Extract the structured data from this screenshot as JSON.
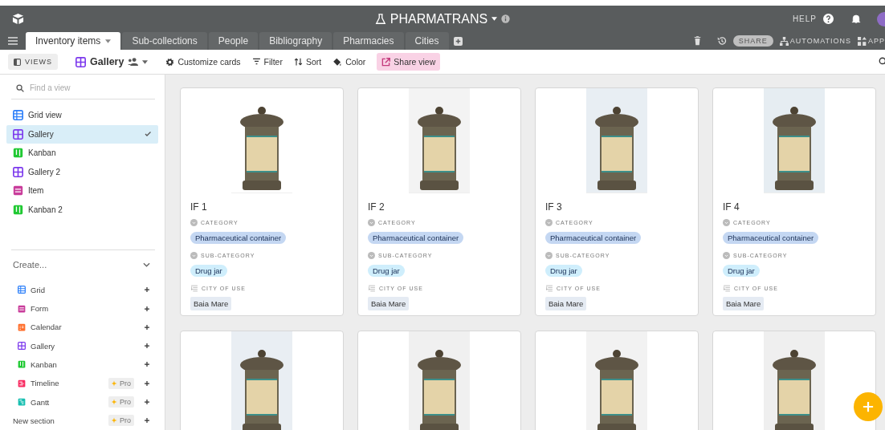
{
  "header": {
    "base_name": "PHARMATRANS",
    "help": "HELP"
  },
  "tabs": [
    {
      "label": "Inventory items",
      "selected": true
    },
    {
      "label": "Sub-collections",
      "selected": false
    },
    {
      "label": "People",
      "selected": false
    },
    {
      "label": "Bibliography",
      "selected": false
    },
    {
      "label": "Pharmacies",
      "selected": false
    },
    {
      "label": "Cities",
      "selected": false
    }
  ],
  "tab_actions": {
    "share": "SHARE",
    "automations": "AUTOMATIONS",
    "apps": "APP"
  },
  "toolbar": {
    "views": "VIEWS",
    "view_name": "Gallery",
    "customize": "Customize cards",
    "filter": "Filter",
    "sort": "Sort",
    "color_label": "Color",
    "share_view": "Share view"
  },
  "sidebar": {
    "search_placeholder": "Find a view",
    "views": [
      {
        "label": "Grid view",
        "kind": "grid",
        "color": "#2d7ff9",
        "selected": false
      },
      {
        "label": "Gallery",
        "kind": "gallery",
        "color": "#7c39ed",
        "selected": true
      },
      {
        "label": "Kanban",
        "kind": "kanban",
        "color": "#20c933",
        "selected": false
      },
      {
        "label": "Gallery 2",
        "kind": "gallery",
        "color": "#7c39ed",
        "selected": false
      },
      {
        "label": "Item",
        "kind": "form",
        "color": "#c93d9b",
        "selected": false
      },
      {
        "label": "Kanban 2",
        "kind": "kanban",
        "color": "#20c933",
        "selected": false
      }
    ],
    "create_label": "Create...",
    "create_items": [
      {
        "label": "Grid",
        "kind": "grid",
        "color": "#2d7ff9"
      },
      {
        "label": "Form",
        "kind": "form",
        "color": "#c93d9b"
      },
      {
        "label": "Calendar",
        "kind": "calendar",
        "color": "#ff6f2c"
      },
      {
        "label": "Gallery",
        "kind": "gallery",
        "color": "#7c39ed"
      },
      {
        "label": "Kanban",
        "kind": "kanban",
        "color": "#20c933"
      },
      {
        "label": "Timeline",
        "kind": "timeline",
        "color": "#f82b60",
        "badge": "Pro"
      },
      {
        "label": "Gantt",
        "kind": "gantt",
        "color": "#18bfb1",
        "badge": "Pro"
      },
      {
        "label": "New section",
        "kind": "section",
        "badge": "Pro"
      }
    ]
  },
  "cards": [
    {
      "title": "IF 1",
      "fields": [
        {
          "label": "CATEGORY",
          "kind": "select",
          "value": "Pharmaceutical container",
          "color": "#c4d7f2"
        },
        {
          "label": "SUB-CATEGORY",
          "kind": "select",
          "value": "Drug jar",
          "color": "#cfeefc"
        },
        {
          "label": "CITY OF USE",
          "kind": "link",
          "value": "Baia Mare"
        }
      ]
    },
    {
      "title": "IF 2",
      "fields": [
        {
          "label": "CATEGORY",
          "kind": "select",
          "value": "Pharmaceutical container",
          "color": "#c4d7f2"
        },
        {
          "label": "SUB-CATEGORY",
          "kind": "select",
          "value": "Drug jar",
          "color": "#cfeefc"
        },
        {
          "label": "CITY OF USE",
          "kind": "link",
          "value": "Baia Mare"
        }
      ]
    },
    {
      "title": "IF 3",
      "fields": [
        {
          "label": "CATEGORY",
          "kind": "select",
          "value": "Pharmaceutical container",
          "color": "#c4d7f2"
        },
        {
          "label": "SUB-CATEGORY",
          "kind": "select",
          "value": "Drug jar",
          "color": "#cfeefc"
        },
        {
          "label": "CITY OF USE",
          "kind": "link",
          "value": "Baia Mare"
        }
      ]
    },
    {
      "title": "IF 4",
      "fields": [
        {
          "label": "CATEGORY",
          "kind": "select",
          "value": "Pharmaceutical container",
          "color": "#c4d7f2"
        },
        {
          "label": "SUB-CATEGORY",
          "kind": "select",
          "value": "Drug jar",
          "color": "#cfeefc"
        },
        {
          "label": "CITY OF USE",
          "kind": "link",
          "value": "Baia Mare"
        }
      ]
    },
    {
      "kind": "photo-only"
    },
    {
      "kind": "photo-only"
    },
    {
      "kind": "photo-only"
    },
    {
      "kind": "photo-only"
    }
  ]
}
